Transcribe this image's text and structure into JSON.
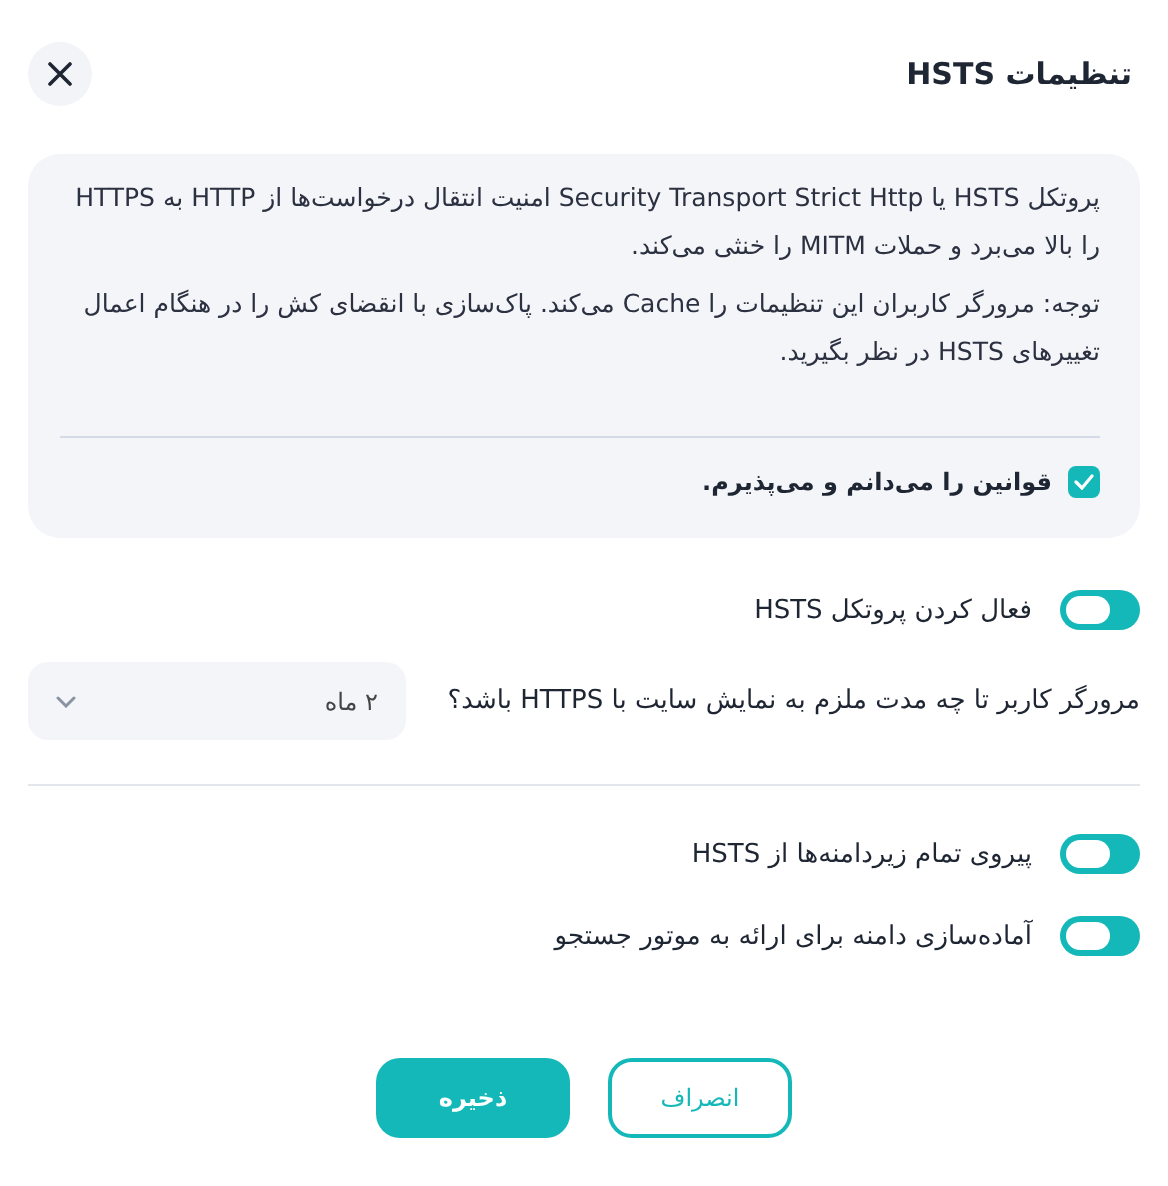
{
  "dialog": {
    "title": "تنظیمات HSTS"
  },
  "info": {
    "paragraphs": [
      "پروتکل HSTS یا Security Transport Strict Http امنیت انتقال درخواست‌ها از HTTP به HTTPS را بالا می‌برد و حملات MITM را خنثی می‌کند.",
      "توجه: مرورگر کاربران این تنظیمات را Cache می‌کند. پاک‌سازی با انقضای کش را در هنگام اعمال تغییرهای HSTS در نظر بگیرید."
    ],
    "agree": {
      "label": "قوانین را می‌دانم و می‌پذیرم.",
      "checked": true
    }
  },
  "enable": {
    "label": "فعال کردن پروتکل HSTS",
    "on": true
  },
  "duration": {
    "label": "مرورگر کاربر تا چه مدت ملزم به نمایش سایت با HTTPS باشد؟",
    "value": "۲ ماه"
  },
  "options": [
    {
      "label": "پیروی تمام زیردامنه‌ها از HSTS",
      "on": true
    },
    {
      "label": "آماده‌سازی دامنه برای ارائه به موتور جستجو",
      "on": true
    }
  ],
  "buttons": [
    {
      "label": "انصراف",
      "kind": "secondary"
    },
    {
      "label": "ذخیره",
      "kind": "primary"
    }
  ]
}
